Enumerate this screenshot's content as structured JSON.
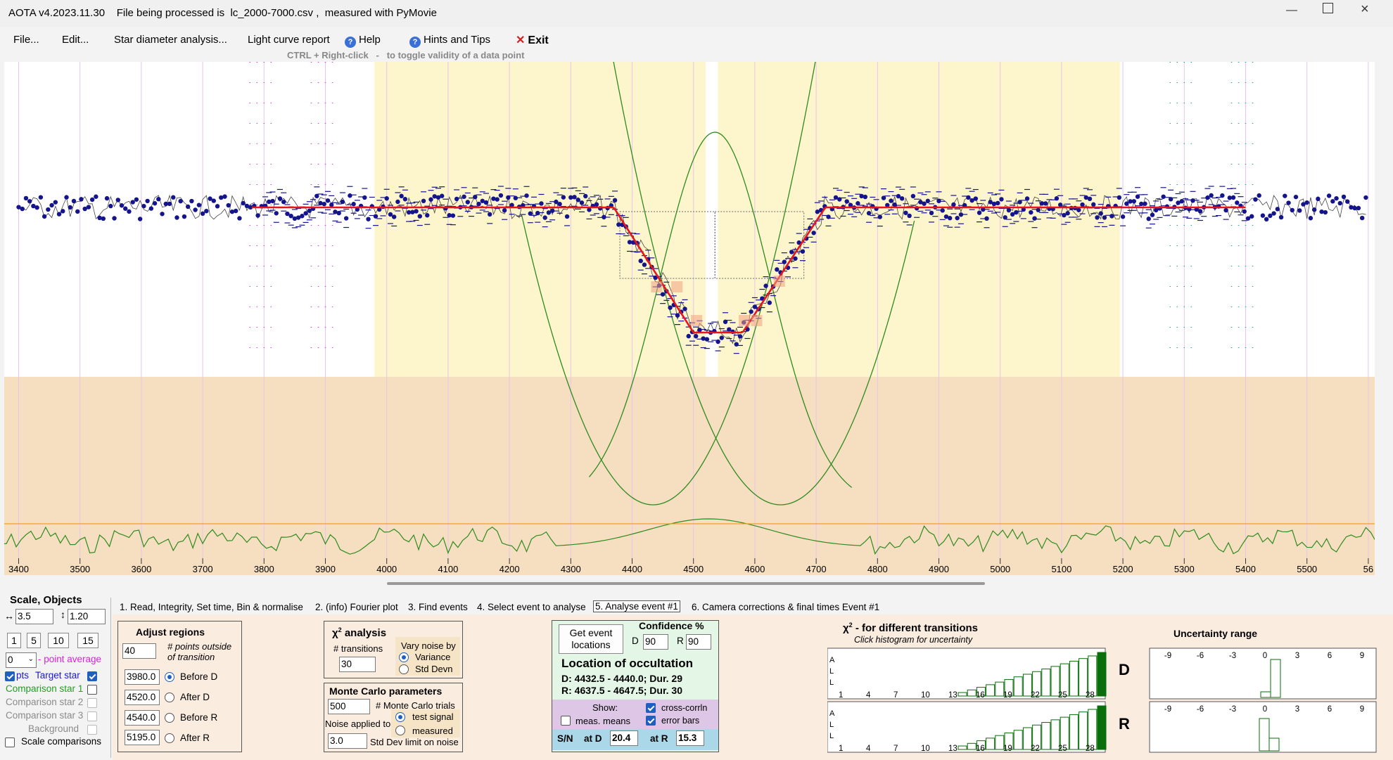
{
  "window": {
    "title": "AOTA v4.2023.11.30    File being processed is  lc_2000-7000.csv ,  measured with PyMovie"
  },
  "menu": {
    "file": "File...",
    "edit": "Edit...",
    "star_diameter": "Star diameter analysis...",
    "light_curve_report": "Light curve report",
    "help": "Help",
    "hints": "Hints and Tips",
    "exit": "Exit",
    "hint_text": "CTRL + Right-click   -   to toggle validity of a data point"
  },
  "plot": {
    "x_ticks": [
      "3400",
      "3500",
      "3600",
      "3700",
      "3800",
      "3900",
      "4000",
      "4100",
      "4200",
      "4300",
      "4400",
      "4500",
      "4600",
      "4700",
      "4800",
      "4900",
      "5000",
      "5100",
      "5200",
      "5300",
      "5400",
      "5500",
      "56"
    ],
    "colors": {
      "baseline_region": "#fdf5cc",
      "lower_region": "#f5dfc0",
      "data_points": "#14148c",
      "model": "#e8161c",
      "chi_curves": "#2f8a1f",
      "noise_line": "#f0a020"
    }
  },
  "left_panel": {
    "heading": "Scale,  Objects",
    "scale_x": "3.5",
    "scale_y": "1.20",
    "avg_buttons": [
      "1",
      "5",
      "10",
      "15"
    ],
    "point_average_value": "0",
    "point_average_label": "- point average",
    "pts_label": "pts",
    "target_star": "Target star",
    "comparison1": "Comparison star 1",
    "comparison2": "Comparison star 2",
    "comparison3": "Comparison star 3",
    "background": "Background",
    "scale_comparisons": "Scale comparisons"
  },
  "tabs": [
    "1.  Read, Integrity, Set time, Bin & normalise",
    "2. (info)  Fourier plot",
    "3. Find events",
    "4. Select event to analyse",
    "5. Analyse event #1",
    "6. Camera corrections & final times Event #1"
  ],
  "adjust_regions": {
    "heading": "Adjust regions",
    "points_outside": "40",
    "points_outside_label": "# points outside of transition",
    "before_d": "3980.0",
    "after_d": "4520.0",
    "before_r": "4540.0",
    "after_r": "5195.0",
    "before_d_label": "Before D",
    "after_d_label": "After D",
    "before_r_label": "Before R",
    "after_r_label": "After R"
  },
  "chi2": {
    "heading": "analysis",
    "transitions_label": "# transitions",
    "transitions": "30",
    "vary_noise_label": "Vary noise by",
    "variance": "Variance",
    "std_devn": "Std Devn"
  },
  "monte_carlo": {
    "heading": "Monte Carlo parameters",
    "trials": "500",
    "trials_label": "# Monte Carlo trials",
    "noise_applied": "Noise applied to",
    "test_signal": "test signal",
    "measured": "measured",
    "std_dev_limit": "3.0",
    "std_dev_label": "Std Dev limit on noise"
  },
  "location": {
    "get_button": "Get event locations",
    "confidence": "Confidence %",
    "d_label": "D",
    "d_value": "90",
    "r_label": "R",
    "r_value": "90",
    "heading": "Location of occultation",
    "d_line": "D: 4432.5 - 4440.0; Dur. 29",
    "r_line": "R: 4637.5 - 4647.5; Dur. 30",
    "show": "Show:",
    "meas_means": "meas. means",
    "cross_corrln": "cross-corrln",
    "error_bars": "error bars",
    "sn_label": "S/N",
    "at_d": "at D",
    "sn_d": "20.4",
    "at_r": "at R",
    "sn_r": "15.3"
  },
  "chi_hist": {
    "heading": "- for different transitions",
    "subheading": "Click histogram for uncertainty",
    "axis_labels": [
      "1",
      "4",
      "7",
      "10",
      "13",
      "16",
      "19",
      "22",
      "25",
      "28",
      "31"
    ],
    "axis_letters": [
      "A",
      "L",
      "L"
    ],
    "d_label": "D",
    "r_label": "R"
  },
  "uncertainty": {
    "heading": "Uncertainty range",
    "ticks": [
      "-9",
      "-6",
      "-3",
      "0",
      "3",
      "6",
      "9"
    ]
  }
}
